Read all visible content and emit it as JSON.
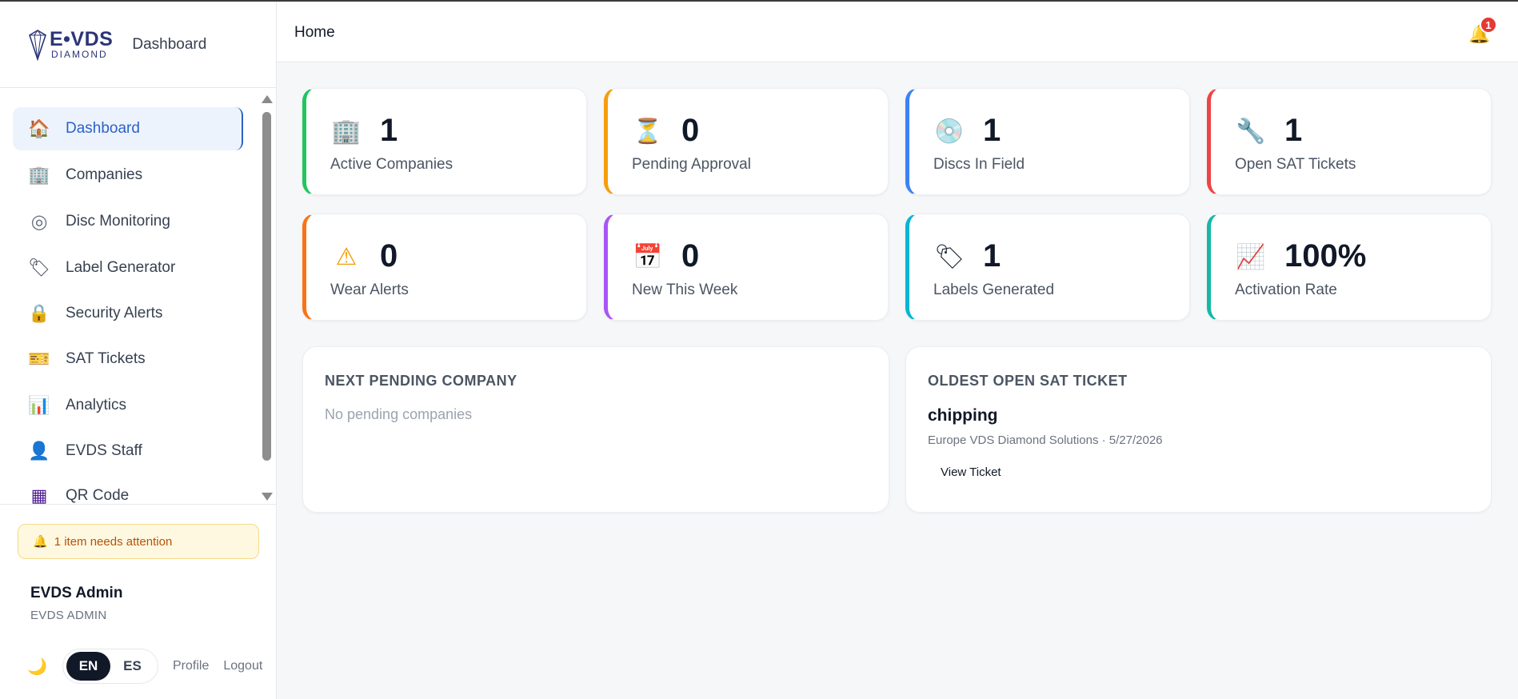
{
  "brand": {
    "logo_main": "E•VDS",
    "logo_sub": "DIAMOND",
    "title": "Dashboard"
  },
  "sidebar": {
    "items": [
      {
        "label": "Dashboard",
        "icon": "house-icon",
        "glyph": "🏠",
        "active": true
      },
      {
        "label": "Companies",
        "icon": "building-icon",
        "glyph": "🏢",
        "active": false
      },
      {
        "label": "Disc Monitoring",
        "icon": "disc-icon",
        "glyph": "◎",
        "active": false
      },
      {
        "label": "Label Generator",
        "icon": "label-tag-icon",
        "glyph": "🏷",
        "active": false
      },
      {
        "label": "Security Alerts",
        "icon": "lock-icon",
        "glyph": "🔒",
        "active": false
      },
      {
        "label": "SAT Tickets",
        "icon": "ticket-icon",
        "glyph": "🎫",
        "active": false
      },
      {
        "label": "Analytics",
        "icon": "bar-chart-icon",
        "glyph": "📊",
        "active": false
      },
      {
        "label": "EVDS Staff",
        "icon": "person-icon",
        "glyph": "👤",
        "active": false
      },
      {
        "label": "QR Code",
        "icon": "qr-code-icon",
        "glyph": "▦",
        "active": false
      }
    ],
    "attention_text": "1 item needs attention",
    "user_name": "EVDS Admin",
    "user_role": "EVDS ADMIN",
    "lang_en": "EN",
    "lang_es": "ES",
    "active_lang": "EN",
    "profile_label": "Profile",
    "logout_label": "Logout"
  },
  "header": {
    "title": "Home",
    "notification_count": "1"
  },
  "stats": [
    {
      "value": "1",
      "label": "Active Companies",
      "icon": "office-building-icon",
      "glyph": "🏢",
      "color": "#22c55e"
    },
    {
      "value": "0",
      "label": "Pending Approval",
      "icon": "hourglass-icon",
      "glyph": "⏳",
      "color": "#f59e0b"
    },
    {
      "value": "1",
      "label": "Discs In Field",
      "icon": "disc-icon",
      "glyph": "💿",
      "color": "#3b82f6"
    },
    {
      "value": "1",
      "label": "Open SAT Tickets",
      "icon": "wrench-icon",
      "glyph": "🔧",
      "color": "#ef4444"
    },
    {
      "value": "0",
      "label": "Wear Alerts",
      "icon": "warning-icon",
      "glyph": "⚠",
      "color": "#f97316"
    },
    {
      "value": "0",
      "label": "New This Week",
      "icon": "calendar-icon",
      "glyph": "📅",
      "color": "#a855f7"
    },
    {
      "value": "1",
      "label": "Labels Generated",
      "icon": "label-tag-icon",
      "glyph": "🏷",
      "color": "#06b6d4"
    },
    {
      "value": "100%",
      "label": "Activation Rate",
      "icon": "trend-chart-icon",
      "glyph": "📈",
      "color": "#14b8a6"
    }
  ],
  "pending_panel": {
    "title": "NEXT PENDING COMPANY",
    "empty_text": "No pending companies"
  },
  "ticket_panel": {
    "title": "OLDEST OPEN SAT TICKET",
    "ticket_title": "chipping",
    "ticket_meta": "Europe VDS Diamond Solutions · 5/27/2026",
    "button_label": "View Ticket"
  }
}
